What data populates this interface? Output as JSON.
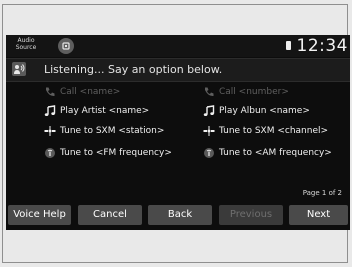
{
  "status_bar": {
    "audio_source_line1": "Audio",
    "audio_source_line2": "Source",
    "home_icon": "home-icon",
    "phone_icon": "phone-status-icon",
    "time": "12:34"
  },
  "prompt": {
    "icon": "voice-command-icon",
    "text": "Listening... Say an option below."
  },
  "options": [
    {
      "icon": "phone-icon",
      "label": "Call <name>",
      "enabled": false
    },
    {
      "icon": "phone-icon",
      "label": "Call <number>",
      "enabled": false
    },
    {
      "icon": "music-note-icon",
      "label": "Play Artist <name>",
      "enabled": true
    },
    {
      "icon": "music-note-icon",
      "label": "Play Albun <name>",
      "enabled": true
    },
    {
      "icon": "satellite-radio-icon",
      "label": "Tune to SXM <station>",
      "enabled": true
    },
    {
      "icon": "satellite-radio-icon",
      "label": "Tune to SXM <channel>",
      "enabled": true
    },
    {
      "icon": "radio-tuner-icon",
      "label": "Tune to <FM frequency>",
      "enabled": true
    },
    {
      "icon": "radio-tuner-icon",
      "label": "Tune to <AM frequency>",
      "enabled": true
    }
  ],
  "page_indicator": "Page 1 of 2",
  "buttons": [
    {
      "label": "Voice Help",
      "enabled": true
    },
    {
      "label": "Cancel",
      "enabled": true
    },
    {
      "label": "Back",
      "enabled": true
    },
    {
      "label": "Previous",
      "enabled": false
    },
    {
      "label": "Next",
      "enabled": true
    }
  ],
  "colors": {
    "screen_background": "#0d0d0d",
    "button_background": "#4a4a4a",
    "disabled_text": "#5f5f5f",
    "text": "#f0f0f0"
  }
}
